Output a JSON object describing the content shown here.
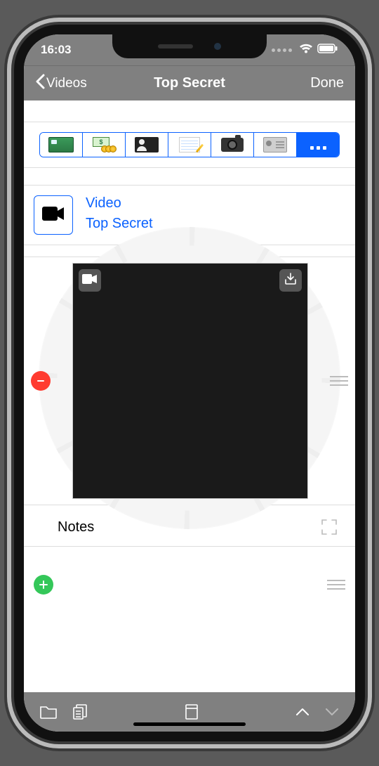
{
  "status": {
    "time": "16:03"
  },
  "nav": {
    "back": "Videos",
    "title": "Top Secret",
    "done": "Done"
  },
  "categories": {
    "items": [
      "credit-card",
      "money",
      "profile",
      "notepad",
      "camera",
      "id-card",
      "more"
    ],
    "selected_index": 6
  },
  "item": {
    "type_label": "Video",
    "title": "Top Secret"
  },
  "notes": {
    "label": "Notes"
  },
  "colors": {
    "accent": "#0b62ff",
    "delete": "#ff3b30",
    "add": "#34c759",
    "chrome": "#808080"
  }
}
